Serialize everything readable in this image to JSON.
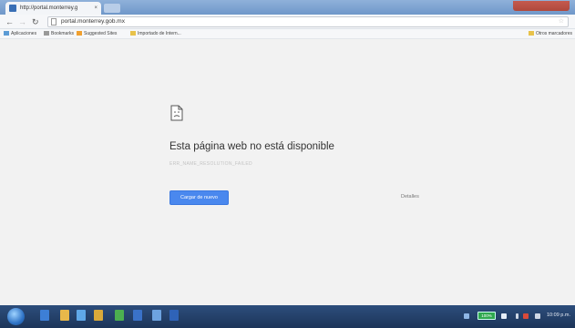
{
  "tab": {
    "title": "http://portal.monterrey.g",
    "close": "×"
  },
  "address": {
    "url": "portal.monterrey.gob.mx"
  },
  "bookmarks": {
    "items": [
      {
        "label": "Aplicaciones",
        "color": "#5b9bd5"
      },
      {
        "label": "Bookmarks",
        "color": "#999999"
      },
      {
        "label": "Suggested Sites",
        "color": "#f0a030"
      },
      {
        "label": "Importado de Intern...",
        "color": "#e8c24a"
      }
    ],
    "other": "Otros marcadores"
  },
  "error": {
    "title": "Esta página web no está disponible",
    "code": "ERR_NAME_RESOLUTION_FAILED",
    "reload_label": "Cargar de nuevo",
    "details_label": "Detalles"
  },
  "taskbar": {
    "tray_badge": "100%",
    "clock": "10:09 p.m."
  }
}
